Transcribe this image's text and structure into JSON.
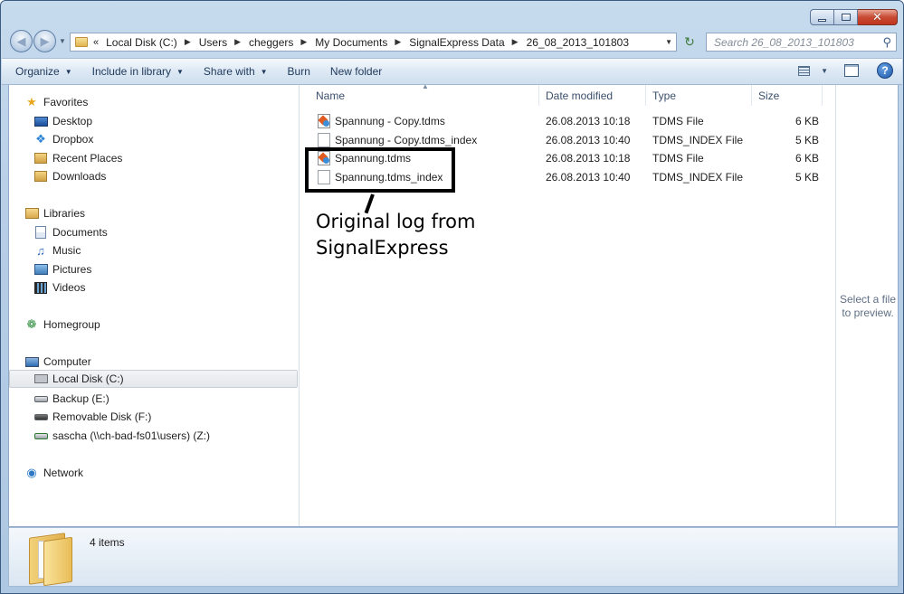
{
  "window": {
    "caption": {
      "minimize": "",
      "maximize": "",
      "close": "✕"
    }
  },
  "address": {
    "crumbs": [
      "Local Disk (C:)",
      "Users",
      "cheggers",
      "My Documents",
      "SignalExpress Data",
      "26_08_2013_101803"
    ],
    "overflow": "«"
  },
  "search": {
    "placeholder": "Search 26_08_2013_101803"
  },
  "toolbar": {
    "organize": "Organize",
    "include_in_library": "Include in library",
    "share_with": "Share with",
    "burn": "Burn",
    "new_folder": "New folder",
    "help": "?"
  },
  "nav": {
    "favorites": "Favorites",
    "desktop": "Desktop",
    "dropbox": "Dropbox",
    "recent_places": "Recent Places",
    "downloads": "Downloads",
    "libraries": "Libraries",
    "documents": "Documents",
    "music": "Music",
    "pictures": "Pictures",
    "videos": "Videos",
    "homegroup": "Homegroup",
    "computer": "Computer",
    "local_disk": "Local Disk (C:)",
    "backup": "Backup (E:)",
    "removable": "Removable Disk (F:)",
    "network_drive": "sascha (\\\\ch-bad-fs01\\users) (Z:)",
    "network": "Network"
  },
  "columns": {
    "name": "Name",
    "date": "Date modified",
    "type": "Type",
    "size": "Size"
  },
  "files": [
    {
      "name": "Spannung - Copy.tdms",
      "date": "26.08.2013 10:18",
      "type": "TDMS File",
      "size": "6 KB",
      "icon": "tdms-icon"
    },
    {
      "name": "Spannung - Copy.tdms_index",
      "date": "26.08.2013 10:40",
      "type": "TDMS_INDEX File",
      "size": "5 KB",
      "icon": "blank-file-icon"
    },
    {
      "name": "Spannung.tdms",
      "date": "26.08.2013 10:18",
      "type": "TDMS File",
      "size": "6 KB",
      "icon": "tdms-icon"
    },
    {
      "name": "Spannung.tdms_index",
      "date": "26.08.2013 10:40",
      "type": "TDMS_INDEX File",
      "size": "5 KB",
      "icon": "blank-file-icon"
    }
  ],
  "annotation": {
    "text": "Original log from\nSignalExpress"
  },
  "preview": {
    "text": "Select a file to preview."
  },
  "details": {
    "item_count": "4 items"
  }
}
